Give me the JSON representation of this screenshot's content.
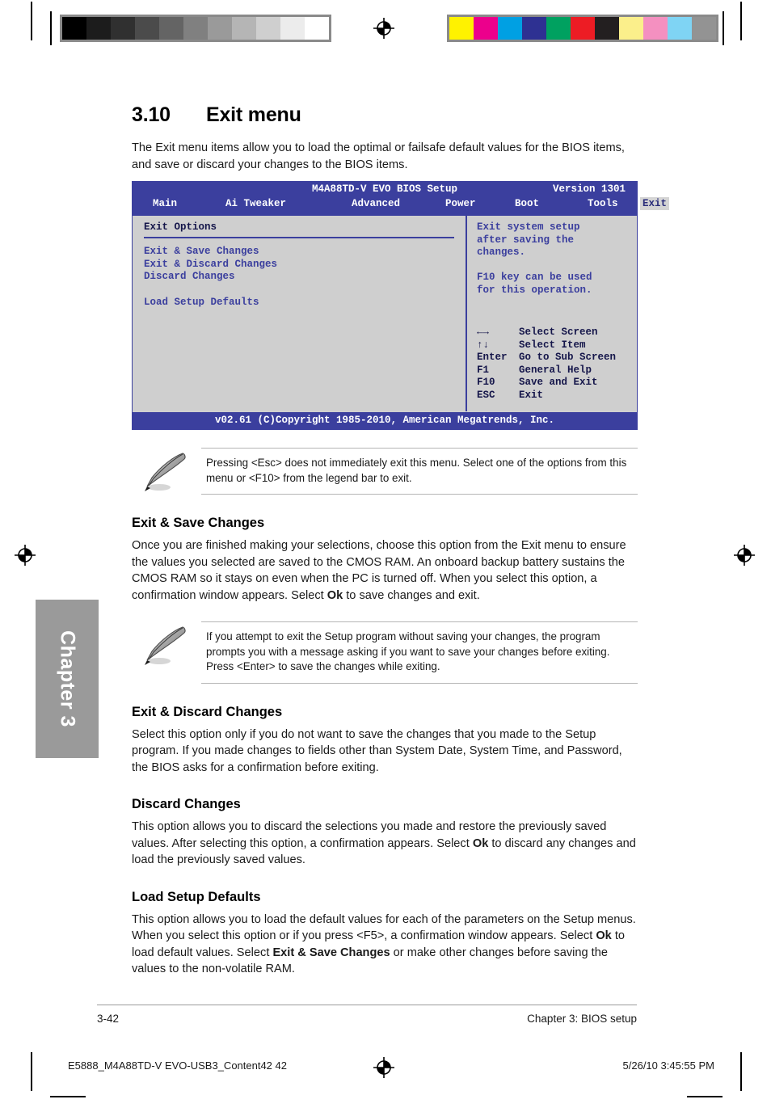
{
  "print_marks": {
    "gray_patches": [
      "#000000",
      "#1c1c1c",
      "#303030",
      "#4b4b4b",
      "#646464",
      "#808080",
      "#9a9a9a",
      "#b5b5b5",
      "#cfcfcf",
      "#ececec",
      "#ffffff"
    ],
    "color_patches": [
      "#fff200",
      "#ec008c",
      "#00a0e3",
      "#2e3192",
      "#00a160",
      "#ed1c24",
      "#231f20",
      "#fbef8b",
      "#f490c0",
      "#7fd4f4",
      "#939393"
    ],
    "registration_icon": "registration-target-icon"
  },
  "chapter_tab": {
    "label": "Chapter 3",
    "color": "#9a9a9a"
  },
  "section": {
    "number": "3.10",
    "title": "Exit menu",
    "intro": "The Exit menu items allow you to load the optimal or failsafe default values for the BIOS items, and save or discard your changes to the BIOS items."
  },
  "bios": {
    "title": "M4A88TD-V EVO BIOS Setup",
    "version": "Version 1301",
    "tabs": [
      {
        "label": "Main",
        "active": false
      },
      {
        "label": "Ai Tweaker",
        "active": false
      },
      {
        "label": "Advanced",
        "active": false
      },
      {
        "label": "Power",
        "active": false
      },
      {
        "label": "Boot",
        "active": false
      },
      {
        "label": "Tools",
        "active": false
      },
      {
        "label": "Exit",
        "active": true
      }
    ],
    "options_header": "Exit Options",
    "items": [
      "Exit & Save Changes",
      "Exit & Discard Changes",
      "Discard Changes",
      "Load Setup Defaults"
    ],
    "help": "Exit system setup\nafter saving the\nchanges.\n\nF10 key can be used\nfor this operation.",
    "legend": [
      {
        "key": "←→",
        "desc": "Select Screen"
      },
      {
        "key": "↑↓",
        "desc": "Select Item"
      },
      {
        "key": "Enter",
        "desc": "Go to Sub Screen"
      },
      {
        "key": "F1",
        "desc": "General Help"
      },
      {
        "key": "F10",
        "desc": "Save and Exit"
      },
      {
        "key": "ESC",
        "desc": "Exit"
      }
    ],
    "footer": "v02.61 (C)Copyright 1985-2010, American Megatrends, Inc.",
    "accent_color": "#3b3f9e",
    "panel_color": "#cfcfcf"
  },
  "notes": [
    {
      "icon": "note-quill-icon",
      "text": "Pressing <Esc> does not immediately exit this menu. Select one of the options from this menu or <F10> from the legend bar to exit."
    },
    {
      "icon": "note-quill-icon",
      "text": "If you attempt to exit the Setup program without saving your changes, the program prompts you with a message asking if you want to save your changes before exiting. Press <Enter> to save the changes while exiting."
    }
  ],
  "subsections": [
    {
      "heading": "Exit & Save Changes",
      "paragraphs": [
        {
          "runs": [
            {
              "t": "Once you are finished making your selections, choose this option from the Exit menu to ensure the values you selected are saved to the CMOS RAM. An onboard backup battery sustains the CMOS RAM so it stays on even when the PC is turned off. When you select this option, a confirmation window appears. Select ",
              "b": false
            },
            {
              "t": "Ok",
              "b": true
            },
            {
              "t": " to save changes and exit.",
              "b": false
            }
          ]
        }
      ]
    },
    {
      "heading": "Exit & Discard Changes",
      "paragraphs": [
        {
          "runs": [
            {
              "t": "Select this option only if you do not want to save the changes that you made to the Setup program. If you made changes to fields other than System Date, System Time, and Password, the BIOS asks for a confirmation before exiting.",
              "b": false
            }
          ]
        }
      ]
    },
    {
      "heading": "Discard Changes",
      "paragraphs": [
        {
          "runs": [
            {
              "t": "This option allows you to discard the selections you made and restore the previously saved values. After selecting this option, a confirmation appears. Select ",
              "b": false
            },
            {
              "t": "Ok",
              "b": true
            },
            {
              "t": " to discard any changes and load the previously saved values.",
              "b": false
            }
          ]
        }
      ]
    },
    {
      "heading": "Load Setup Defaults",
      "paragraphs": [
        {
          "runs": [
            {
              "t": "This option allows you to load the default values for each of the parameters on the Setup menus. When you select this option or if you press <F5>, a confirmation window appears. Select ",
              "b": false
            },
            {
              "t": "Ok",
              "b": true
            },
            {
              "t": " to load default values. Select ",
              "b": false
            },
            {
              "t": "Exit & Save Changes",
              "b": true
            },
            {
              "t": " or make other changes before saving the values to the non-volatile RAM.",
              "b": false
            }
          ]
        }
      ]
    }
  ],
  "page_footer": {
    "page_number": "3-42",
    "chapter_label": "Chapter 3: BIOS setup"
  },
  "print_footer": {
    "file": "E5888_M4A88TD-V EVO-USB3_Content42   42",
    "date": "5/26/10   3:45:55 PM"
  }
}
